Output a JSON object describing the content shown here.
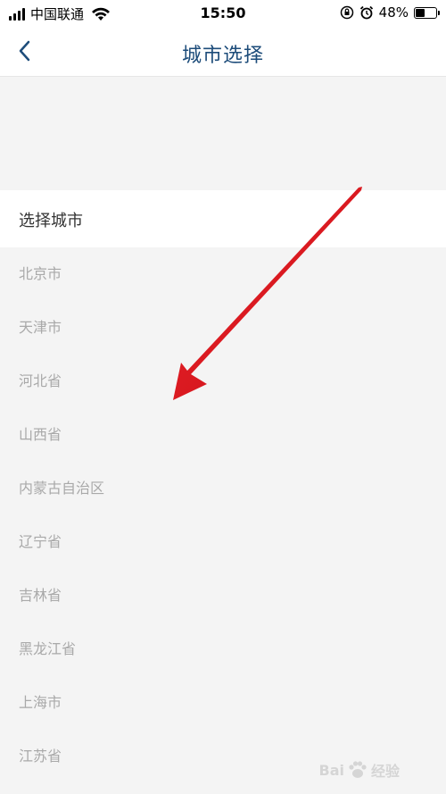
{
  "status_bar": {
    "carrier": "中国联通",
    "time": "15:50",
    "battery": "48%",
    "battery_level": 0.48
  },
  "nav": {
    "title": "城市选择"
  },
  "section": {
    "label": "选择城市"
  },
  "cities": [
    "北京市",
    "天津市",
    "河北省",
    "山西省",
    "内蒙古自治区",
    "辽宁省",
    "吉林省",
    "黑龙江省",
    "上海市",
    "江苏省"
  ],
  "colors": {
    "nav_title": "#1d4c7a",
    "arrow": "#e8141c",
    "list_text": "#a9a9a9",
    "background": "#f4f4f4"
  },
  "watermark": {
    "left": "Bai",
    "right": "经验"
  }
}
